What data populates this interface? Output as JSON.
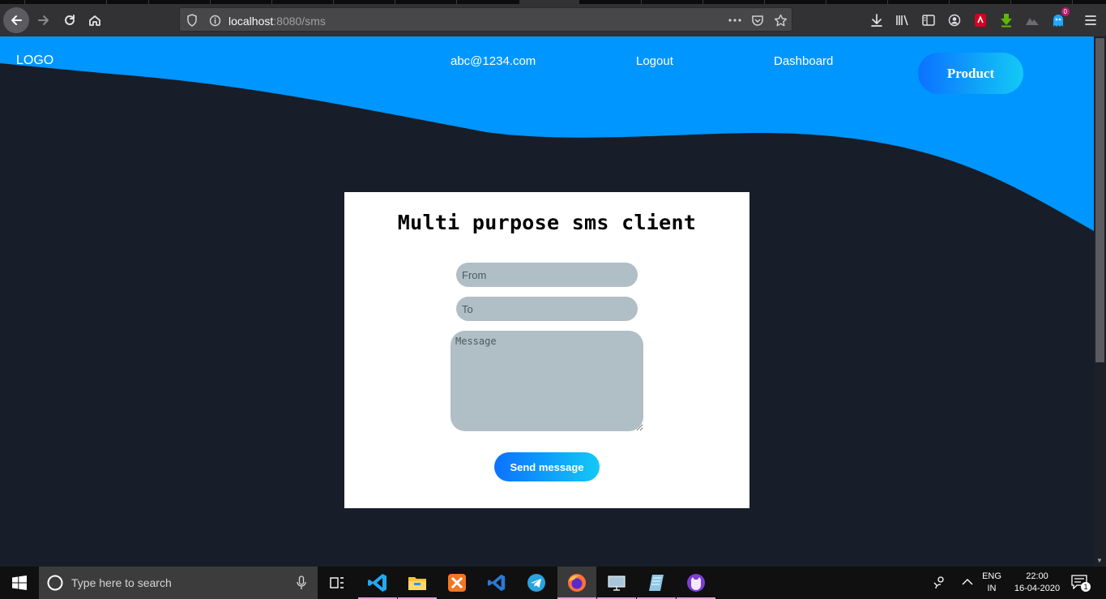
{
  "browser": {
    "url_host": "localhost",
    "url_rest": ":8080/sms",
    "addon_badge": "0"
  },
  "nav": {
    "logo": "LOGO",
    "email": "abc@1234.com",
    "logout": "Logout",
    "dashboard": "Dashboard",
    "product": "Product"
  },
  "form": {
    "title": "Multi purpose sms client",
    "from_placeholder": "From",
    "to_placeholder": "To",
    "message_placeholder": "Message",
    "send_label": "Send message"
  },
  "taskbar": {
    "search_placeholder": "Type here to search",
    "lang_top": "ENG",
    "lang_bottom": "IN",
    "time": "22:00",
    "date": "16-04-2020",
    "notif_count": "1"
  },
  "colors": {
    "accent": "#0096ff",
    "page_bg": "#171e29",
    "field_bg": "#b0bec5",
    "gradient_start": "#0b72ff",
    "gradient_end": "#13c9f6"
  }
}
